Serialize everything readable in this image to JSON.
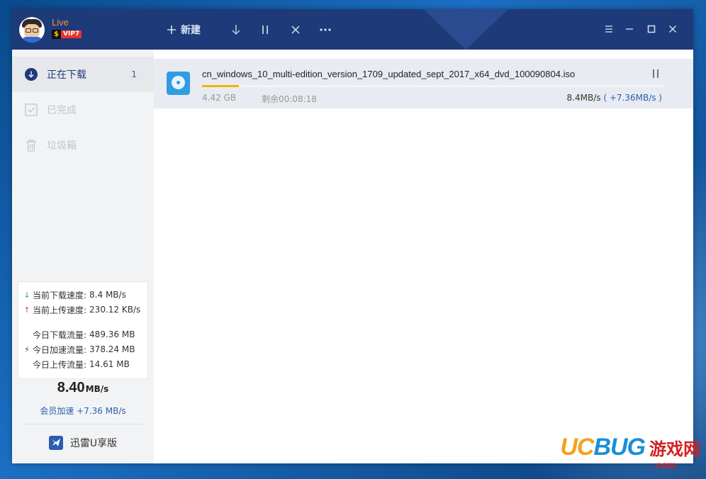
{
  "titlebar": {
    "live_label": "Live",
    "vip_s": "$",
    "vip_label": "VIP7",
    "new_label": "新建",
    "colors": {
      "bg": "#1e3a78",
      "accent": "#ff8a3c"
    }
  },
  "sidebar": {
    "items": [
      {
        "label": "正在下载",
        "count": "1",
        "icon": "download-circle-icon"
      },
      {
        "label": "已完成",
        "icon": "checkbox-icon"
      },
      {
        "label": "垃圾箱",
        "icon": "trash-icon"
      }
    ],
    "stats": {
      "down_speed_label": "当前下载速度:",
      "down_speed_value": "8.4 MB/s",
      "up_speed_label": "当前上传速度:",
      "up_speed_value": "230.12 KB/s",
      "today_down_label": "今日下载流量:",
      "today_down_value": "489.36 MB",
      "today_accel_label": "今日加速流量:",
      "today_accel_value": "378.24 MB",
      "today_up_label": "今日上传流量:",
      "today_up_value": "14.61 MB"
    },
    "big_speed": "8.40",
    "big_speed_unit": "MB/s",
    "member_accel": "会员加速 +7.36 MB/s",
    "uban_label": "迅雷U享版"
  },
  "task": {
    "filename": "cn_windows_10_multi-edition_version_1709_updated_sept_2017_x64_dvd_100090804.iso",
    "size": "4.42 GB",
    "remaining": "剩余00:08:18",
    "speed": "8.4MB/s",
    "accel": "( +7.36MB/s )",
    "progress": 0.08,
    "icon": "disc-icon"
  },
  "watermark": {
    "uc": "UC",
    "bug": "BUG",
    "cn": "游戏网",
    "com": ".com"
  }
}
